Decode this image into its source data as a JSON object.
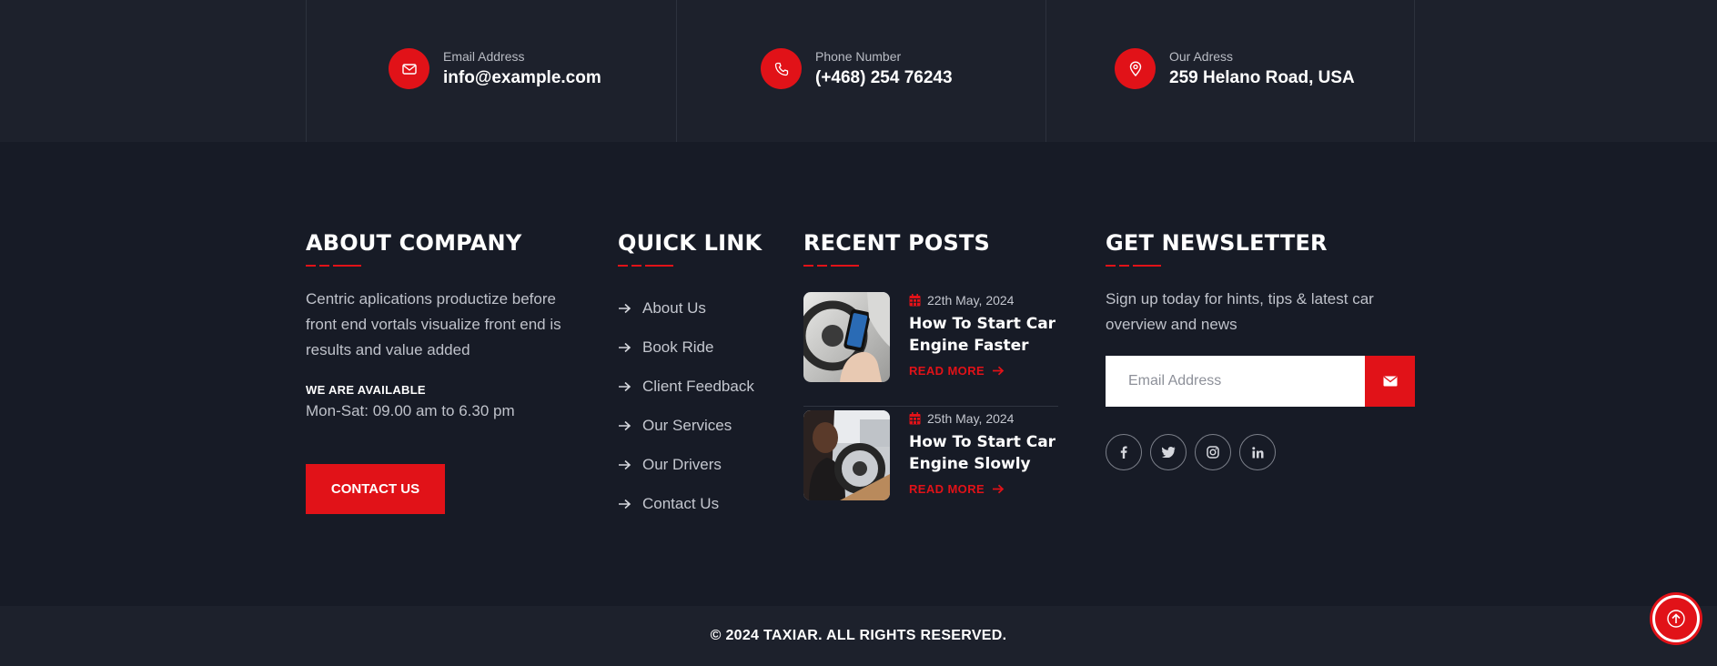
{
  "contact": {
    "email": {
      "label": "Email Address",
      "value": "info@example.com"
    },
    "phone": {
      "label": "Phone Number",
      "value": "(+468) 254 76243"
    },
    "address": {
      "label": "Our Adress",
      "value": "259 Helano Road, USA"
    }
  },
  "about": {
    "title": "ABOUT COMPANY",
    "text": "Centric aplications productize before front end vortals visualize front end is results and value added",
    "available_label": "WE ARE AVAILABLE",
    "hours": "Mon-Sat: 09.00 am to 6.30 pm",
    "button_label": "CONTACT US"
  },
  "quick_links": {
    "title": "QUICK LINK",
    "items": [
      "About Us",
      "Book Ride",
      "Client Feedback",
      "Our Services",
      "Our Drivers",
      "Contact Us"
    ]
  },
  "recent_posts": {
    "title": "RECENT POSTS",
    "posts": [
      {
        "date": "22th May, 2024",
        "title": "How To Start Car Engine Faster",
        "more": "READ MORE"
      },
      {
        "date": "25th May, 2024",
        "title": "How To Start Car Engine Slowly",
        "more": "READ MORE"
      }
    ]
  },
  "newsletter": {
    "title": "GET NEWSLETTER",
    "text": "Sign up today for hints, tips & latest car overview and news",
    "placeholder": "Email Address",
    "socials": [
      "facebook-icon",
      "twitter-icon",
      "instagram-icon",
      "linkedin-icon"
    ]
  },
  "footer": {
    "copyright": "© 2024 TAXIAR. ALL RIGHTS RESERVED."
  },
  "colors": {
    "accent": "#e11218",
    "background": "#171b26",
    "strip": "#1d212c"
  }
}
